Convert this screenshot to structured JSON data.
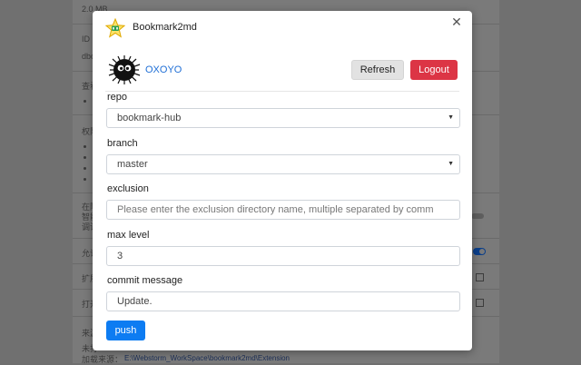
{
  "background": {
    "texts": [
      "2.0 MB",
      "ID",
      "dbc",
      "查看",
      "权限",
      "在隐",
      "智能",
      "调试",
      "允许",
      "扩展",
      "打开",
      "来源",
      "未打",
      "加载来源："
    ],
    "load_path": "E:\\Webstorm_WorkSpace\\bookmark2md\\Extension"
  },
  "dialog": {
    "title": "Bookmark2md",
    "close_icon": "close-icon",
    "username": "OXOYO",
    "refresh_label": "Refresh",
    "logout_label": "Logout",
    "repo": {
      "label": "repo",
      "value": "bookmark-hub"
    },
    "branch": {
      "label": "branch",
      "value": "master"
    },
    "exclusion": {
      "label": "exclusion",
      "placeholder": "Please enter the exclusion directory name, multiple separated by comm"
    },
    "max_level": {
      "label": "max level",
      "value": "3"
    },
    "commit_message": {
      "label": "commit message",
      "value": "Update."
    },
    "push_label": "push"
  },
  "colors": {
    "accent": "#0d7cf2",
    "danger": "#dc3545",
    "link": "#1f6fd6"
  }
}
